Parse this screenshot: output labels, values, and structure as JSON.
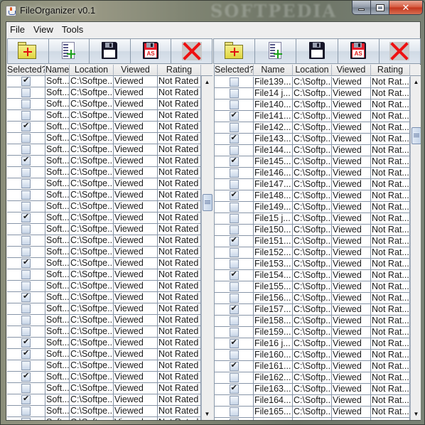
{
  "window": {
    "title": "FileOrganizer v0.1",
    "watermark": "SOFTPEDIA",
    "close_glyph": "✕"
  },
  "menu": [
    "File",
    "View",
    "Tools"
  ],
  "toolbar": {
    "buttons": [
      {
        "name": "add-folder",
        "icon": "folder-plus-icon"
      },
      {
        "name": "add-file",
        "icon": "document-plus-icon"
      },
      {
        "name": "save",
        "icon": "floppy-disk-icon"
      },
      {
        "name": "save-as",
        "icon": "floppy-disk-save-as-icon",
        "badge": "AS"
      },
      {
        "name": "remove",
        "icon": "red-x-icon"
      }
    ]
  },
  "columns": [
    "Selected?",
    "Name",
    "Location",
    "Viewed",
    "Rating"
  ],
  "left_table": {
    "columns": [
      "Selected?",
      "Name",
      "Location",
      "Viewed",
      "Rating"
    ],
    "row_template": {
      "name": "Soft...",
      "location": "C:\\Softpe...",
      "viewed": "Viewed",
      "rating": "Not Rated"
    },
    "selected": [
      true,
      false,
      false,
      false,
      true,
      false,
      false,
      true,
      false,
      false,
      false,
      false,
      true,
      false,
      false,
      false,
      true,
      false,
      false,
      true,
      false,
      false,
      false,
      true,
      true,
      false,
      true,
      false,
      true,
      false,
      false
    ],
    "scroll_position": 0.35
  },
  "right_table": {
    "columns": [
      "Selected?",
      "Name",
      "Location",
      "Viewed",
      "Rating"
    ],
    "rows": [
      {
        "selected": false,
        "name": "File139...",
        "location": "C:\\Softp...",
        "viewed": "Viewed",
        "rating": "Not Rat..."
      },
      {
        "selected": false,
        "name": "File14 j...",
        "location": "C:\\Softp...",
        "viewed": "Viewed",
        "rating": "Not Rat..."
      },
      {
        "selected": false,
        "name": "File140...",
        "location": "C:\\Softp...",
        "viewed": "Viewed",
        "rating": "Not Rat..."
      },
      {
        "selected": true,
        "name": "File141...",
        "location": "C:\\Softp...",
        "viewed": "Viewed",
        "rating": "Not Rat..."
      },
      {
        "selected": false,
        "name": "File142...",
        "location": "C:\\Softp...",
        "viewed": "Viewed",
        "rating": "Not Rat..."
      },
      {
        "selected": true,
        "name": "File143...",
        "location": "C:\\Softp...",
        "viewed": "Viewed",
        "rating": "Not Rat..."
      },
      {
        "selected": false,
        "name": "File144...",
        "location": "C:\\Softp...",
        "viewed": "Viewed",
        "rating": "Not Rat..."
      },
      {
        "selected": true,
        "name": "File145...",
        "location": "C:\\Softp...",
        "viewed": "Viewed",
        "rating": "Not Rat..."
      },
      {
        "selected": false,
        "name": "File146...",
        "location": "C:\\Softp...",
        "viewed": "Viewed",
        "rating": "Not Rat..."
      },
      {
        "selected": false,
        "name": "File147...",
        "location": "C:\\Softp...",
        "viewed": "Viewed",
        "rating": "Not Rat..."
      },
      {
        "selected": true,
        "name": "File148...",
        "location": "C:\\Softp...",
        "viewed": "Viewed",
        "rating": "Not Rat..."
      },
      {
        "selected": false,
        "name": "File149...",
        "location": "C:\\Softp...",
        "viewed": "Viewed",
        "rating": "Not Rat..."
      },
      {
        "selected": false,
        "name": "File15 j...",
        "location": "C:\\Softp...",
        "viewed": "Viewed",
        "rating": "Not Rat..."
      },
      {
        "selected": false,
        "name": "File150...",
        "location": "C:\\Softp...",
        "viewed": "Viewed",
        "rating": "Not Rat..."
      },
      {
        "selected": true,
        "name": "File151...",
        "location": "C:\\Softp...",
        "viewed": "Viewed",
        "rating": "Not Rat..."
      },
      {
        "selected": false,
        "name": "File152...",
        "location": "C:\\Softp...",
        "viewed": "Viewed",
        "rating": "Not Rat..."
      },
      {
        "selected": false,
        "name": "File153...",
        "location": "C:\\Softp...",
        "viewed": "Viewed",
        "rating": "Not Rat..."
      },
      {
        "selected": true,
        "name": "File154...",
        "location": "C:\\Softp...",
        "viewed": "Viewed",
        "rating": "Not Rat..."
      },
      {
        "selected": false,
        "name": "File155...",
        "location": "C:\\Softp...",
        "viewed": "Viewed",
        "rating": "Not Rat..."
      },
      {
        "selected": false,
        "name": "File156...",
        "location": "C:\\Softp...",
        "viewed": "Viewed",
        "rating": "Not Rat..."
      },
      {
        "selected": true,
        "name": "File157...",
        "location": "C:\\Softp...",
        "viewed": "Viewed",
        "rating": "Not Rat..."
      },
      {
        "selected": false,
        "name": "File158...",
        "location": "C:\\Softp...",
        "viewed": "Viewed",
        "rating": "Not Rat..."
      },
      {
        "selected": false,
        "name": "File159...",
        "location": "C:\\Softp...",
        "viewed": "Viewed",
        "rating": "Not Rat..."
      },
      {
        "selected": true,
        "name": "File16 j...",
        "location": "C:\\Softp...",
        "viewed": "Viewed",
        "rating": "Not Rat..."
      },
      {
        "selected": false,
        "name": "File160...",
        "location": "C:\\Softp...",
        "viewed": "Viewed",
        "rating": "Not Rat..."
      },
      {
        "selected": true,
        "name": "File161...",
        "location": "C:\\Softp...",
        "viewed": "Viewed",
        "rating": "Not Rat..."
      },
      {
        "selected": false,
        "name": "File162...",
        "location": "C:\\Softp...",
        "viewed": "Viewed",
        "rating": "Not Rat..."
      },
      {
        "selected": true,
        "name": "File163...",
        "location": "C:\\Softp...",
        "viewed": "Viewed",
        "rating": "Not Rat..."
      },
      {
        "selected": false,
        "name": "File164...",
        "location": "C:\\Softp...",
        "viewed": "Viewed",
        "rating": "Not Rat..."
      },
      {
        "selected": false,
        "name": "File165...",
        "location": "C:\\Softp...",
        "viewed": "Viewed",
        "rating": "Not Rat..."
      },
      {
        "selected": false,
        "name": "",
        "location": "",
        "viewed": "",
        "rating": ""
      }
    ],
    "scroll_position": 0.13
  },
  "scroll_arrows": {
    "up": "▲",
    "down": "▼"
  }
}
